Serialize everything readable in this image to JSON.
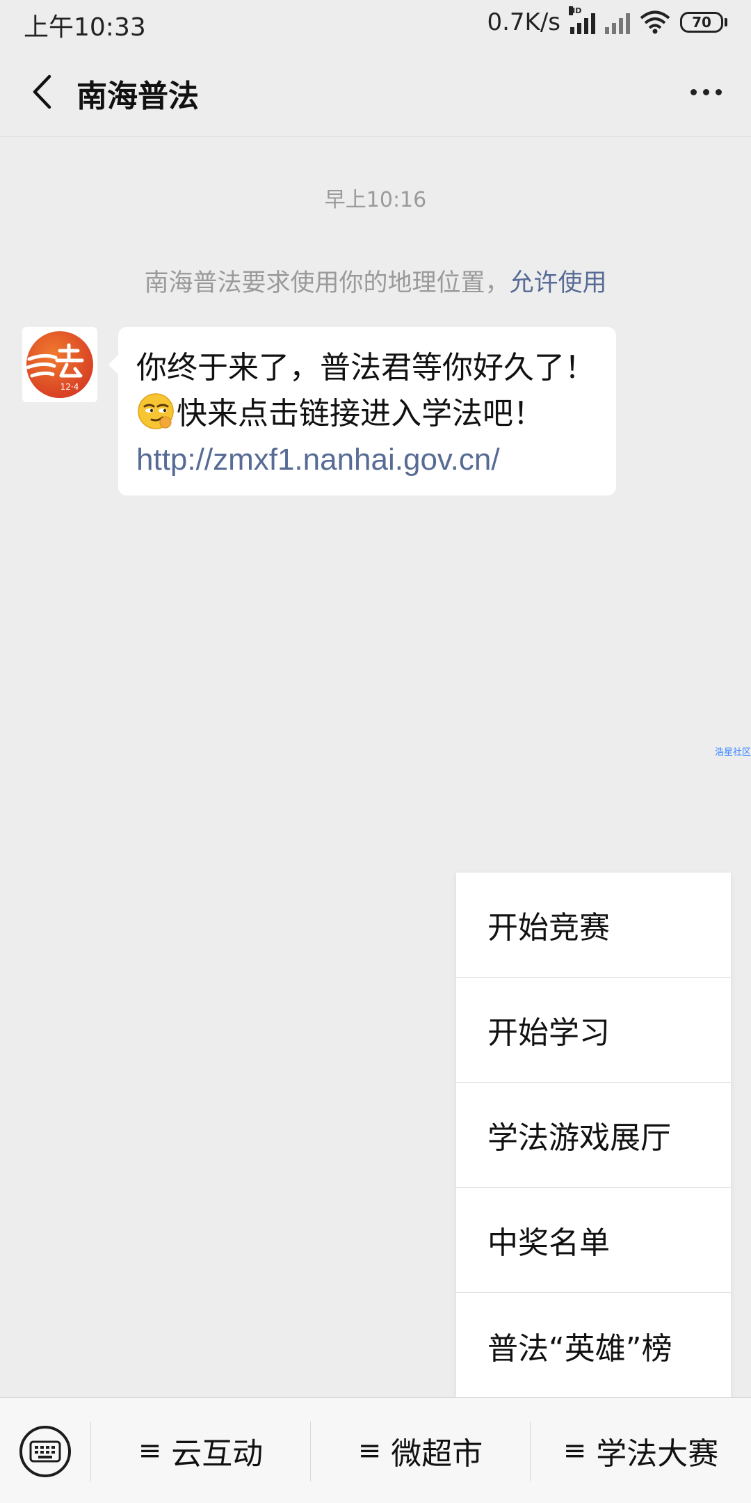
{
  "status_bar": {
    "time": "上午10:33",
    "net_speed": "0.7K/s",
    "hd_label": "HD",
    "battery": "70"
  },
  "nav": {
    "title": "南海普法"
  },
  "chat": {
    "timestamp": "早上10:16",
    "system_message": "南海普法要求使用你的地理位置，",
    "allow_link": "允许使用",
    "message_line1": "你终于来了，普法君等你好久了！",
    "message_line2": "快来点击链接进入学法吧！",
    "message_link": "http://zmxf1.nanhai.gov.cn/",
    "avatar_text": "12·4"
  },
  "watermark": "浩星社区",
  "popup_menu": {
    "items": [
      "开始竞赛",
      "开始学习",
      "学法游戏展厅",
      "中奖名单",
      "普法“英雄”榜"
    ]
  },
  "bottom_bar": {
    "menu_glyph": "≡",
    "menus": [
      "云互动",
      "微超市",
      "学法大赛"
    ]
  },
  "colors": {
    "background": "#ededed",
    "link": "#576b95",
    "avatar_orange": "#e8532a"
  }
}
